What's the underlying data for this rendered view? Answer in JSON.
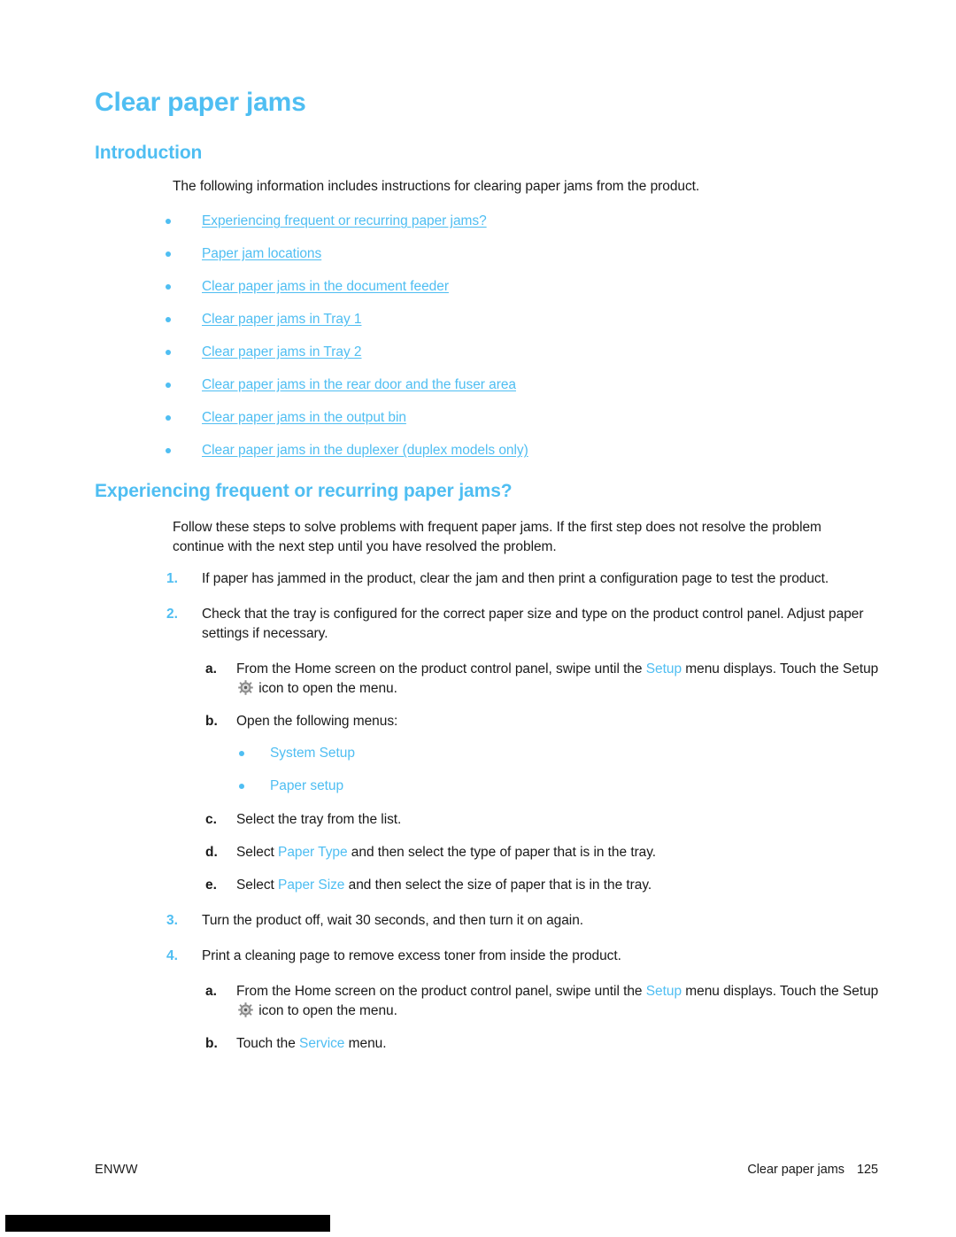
{
  "document": {
    "title": "Clear paper jams",
    "accent_color": "#4FBEF2",
    "text_color": "#1a1a1a"
  },
  "intro": {
    "heading": "Introduction",
    "paragraph": "The following information includes instructions for clearing paper jams from the product.",
    "links": [
      "Experiencing frequent or recurring paper jams?",
      "Paper jam locations",
      "Clear paper jams in the document feeder",
      "Clear paper jams in Tray 1",
      "Clear paper jams in Tray 2",
      "Clear paper jams in the rear door and the fuser area",
      "Clear paper jams in the output bin",
      "Clear paper jams in the duplexer (duplex models only)"
    ]
  },
  "section": {
    "heading": "Experiencing frequent or recurring paper jams?",
    "intro": "Follow these steps to solve problems with frequent paper jams. If the first step does not resolve the problem continue with the next step until you have resolved the problem.",
    "steps": [
      {
        "num": "1.",
        "text": "If paper has jammed in the product, clear the jam and then print a configuration page to test the product."
      },
      {
        "num": "2.",
        "text": "Check that the tray is configured for the correct paper size and type on the product control panel. Adjust paper settings if necessary."
      },
      {
        "num": "3.",
        "text": "Turn the product off, wait 30 seconds, and then turn it on again."
      },
      {
        "num": "4.",
        "text": "Print a cleaning page to remove excess toner from inside the product."
      }
    ],
    "step2_substeps": {
      "a": {
        "letter": "a.",
        "part1": "From the Home screen on the product control panel, swipe until the ",
        "ui1": "Setup",
        "part2": " menu displays. Touch the Setup ",
        "icon": "gear-icon",
        "part3": " icon to open the menu."
      },
      "b": {
        "letter": "b.",
        "text": "Open the following menus:"
      },
      "menus": [
        "System Setup",
        "Paper setup"
      ],
      "c": {
        "letter": "c.",
        "text": "Select the tray from the list."
      },
      "d": {
        "letter": "d.",
        "part1": "Select ",
        "ui1": "Paper Type",
        "part2": " and then select the type of paper that is in the tray."
      },
      "e": {
        "letter": "e.",
        "part1": "Select ",
        "ui1": "Paper Size",
        "part2": " and then select the size of paper that is in the tray."
      }
    },
    "step4_substeps": {
      "a": {
        "letter": "a.",
        "part1": "From the Home screen on the product control panel, swipe until the ",
        "ui1": "Setup",
        "part2": " menu displays. Touch the Setup ",
        "icon": "gear-icon",
        "part3": " icon to open the menu."
      },
      "b": {
        "letter": "b.",
        "part1": "Touch the ",
        "ui1": "Service",
        "part2": " menu."
      }
    }
  },
  "footer": {
    "left": "ENWW",
    "section": "Clear paper jams",
    "page": "125"
  }
}
